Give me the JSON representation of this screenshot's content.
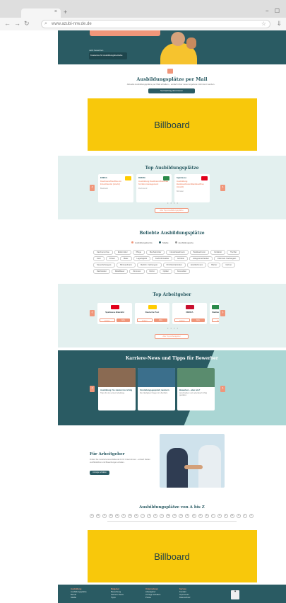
{
  "browser": {
    "tab_close": "×",
    "new_tab": "+",
    "url": "www.azubi-nrw.de.de",
    "window_controls": "− ☐"
  },
  "hero": {
    "badge": "Jetzt bewerben",
    "card_text": "Kostenlos für Ausbildungsbetriebe"
  },
  "mail": {
    "title": "Ausbildungsplätze per Mail",
    "text": "Aktuelle Ausbildungsplätze per Mail erhalten – einfach über neue Angebote informiert werden.",
    "button": "Suchauftrag abonnieren"
  },
  "billboard_top": {
    "label": "Billboard"
  },
  "top_jobs": {
    "title": "Top Ausbildungsplätze",
    "prev": "‹",
    "next": "›",
    "dots": "• • • •",
    "button": "Alle Top-Ausbildungsplätze",
    "cards": [
      {
        "company": "EDEKA",
        "title": "Kaufmann/Kauffrau im Einzelhandel (m/w/d)",
        "location": "Bielefeld",
        "logo_color": "#ffcc00"
      },
      {
        "company": "DEKRA",
        "title": "Ausbildung Kaufmann/Kauffrau für Büromanagement",
        "location": "Dortmund",
        "logo_color": "#2a8a4a"
      },
      {
        "company": "Sparkasse",
        "title": "Ausbildung Bankkaufmann/Bankkauffrau (m/w/d)",
        "location": "Münster",
        "logo_color": "#e2001a"
      }
    ]
  },
  "popular": {
    "title": "Beliebte Ausbildungsplätze",
    "tabs": [
      {
        "label": "Ausbildungsberufe",
        "color": "#f0967a"
      },
      {
        "label": "Städte",
        "color": "#2a5b63"
      },
      {
        "label": "Ausbildungsorte",
        "color": "#999999"
      }
    ],
    "chips": [
      "Kaufmann/-frau",
      "Elektroniker",
      "Pflege",
      "Mechatroniker",
      "Industriekaufmann",
      "Bankkaufmann",
      "Verkäufer",
      "Tischler",
      "Koch",
      "Friseur",
      "Maler",
      "Lagerlogistik",
      "Fachinformatiker",
      "Erzieher",
      "Anlagenmechaniker",
      "Zahnmed. Fachangest.",
      "Steuerfachangest.",
      "Bürokaufmann",
      "Medizin. Fachangest.",
      "KFZ-Mechatroniker",
      "Hotelfachmann",
      "Bäcker",
      "Gärtner",
      "Dachdecker",
      "Metallbauer",
      "Zimmerer",
      "Florist",
      "Optiker",
      "Kosmetiker"
    ]
  },
  "top_employers": {
    "title": "Top Arbeitgeber",
    "prev": "‹",
    "next": "›",
    "dots": "• • • •",
    "button": "Alle Top-Arbeitgeber",
    "follow": "Folgen",
    "jobs": "Jobs",
    "cards": [
      {
        "name": "Sparkasse Bielefeld",
        "logo_color": "#e2001a"
      },
      {
        "name": "Deutsche Post",
        "logo_color": "#ffcc00"
      },
      {
        "name": "DEKRA",
        "logo_color": "#c8102e"
      },
      {
        "name": "Stadtwerke",
        "logo_color": "#2a8a4a"
      }
    ]
  },
  "news": {
    "title": "Karriere-News und Tipps für Bewerber",
    "prev": "‹",
    "next": "›",
    "cards": [
      {
        "title": "Ausbildung: So startest du richtig",
        "text": "Tipps für den ersten Arbeitstag.",
        "img_color": "#8a6a52"
      },
      {
        "title": "Vorstellungsgespräch meistern",
        "text": "Die häufigsten Fragen im Überblick.",
        "img_color": "#3b6f8c"
      },
      {
        "title": "Bewerben – aber wie?",
        "text": "Anschreiben und Lebenslauf richtig gestalten.",
        "img_color": "#5a8c6e"
      }
    ]
  },
  "employers": {
    "title": "Für Arbeitgeber",
    "text": "Finden Sie motivierte Auszubildende für Ihr Unternehmen – einfach Stellen veröffentlichen und Bewerbungen erhalten.",
    "button": "Anzeige schalten"
  },
  "az": {
    "title": "Ausbildungsplätze von A bis Z",
    "letters": [
      "A",
      "B",
      "C",
      "D",
      "E",
      "F",
      "G",
      "H",
      "I",
      "J",
      "K",
      "L",
      "M",
      "N",
      "O",
      "P",
      "Q",
      "R",
      "S",
      "T",
      "U",
      "V",
      "W",
      "X",
      "Y",
      "Z"
    ]
  },
  "billboard_bottom": {
    "label": "Billboard"
  },
  "footer": {
    "cols": [
      {
        "head": "Ausbildung",
        "items": [
          "Ausbildungsplätze",
          "Berufe",
          "Städte"
        ]
      },
      {
        "head": "Ratgeber",
        "items": [
          "Bewerbung",
          "Karriere-News",
          "Tipps"
        ]
      },
      {
        "head": "Unternehmen",
        "items": [
          "Arbeitgeber",
          "Anzeige schalten",
          "Preise"
        ]
      },
      {
        "head": "Service",
        "items": [
          "Kontakt",
          "Impressum",
          "Datenschutz"
        ]
      }
    ]
  }
}
